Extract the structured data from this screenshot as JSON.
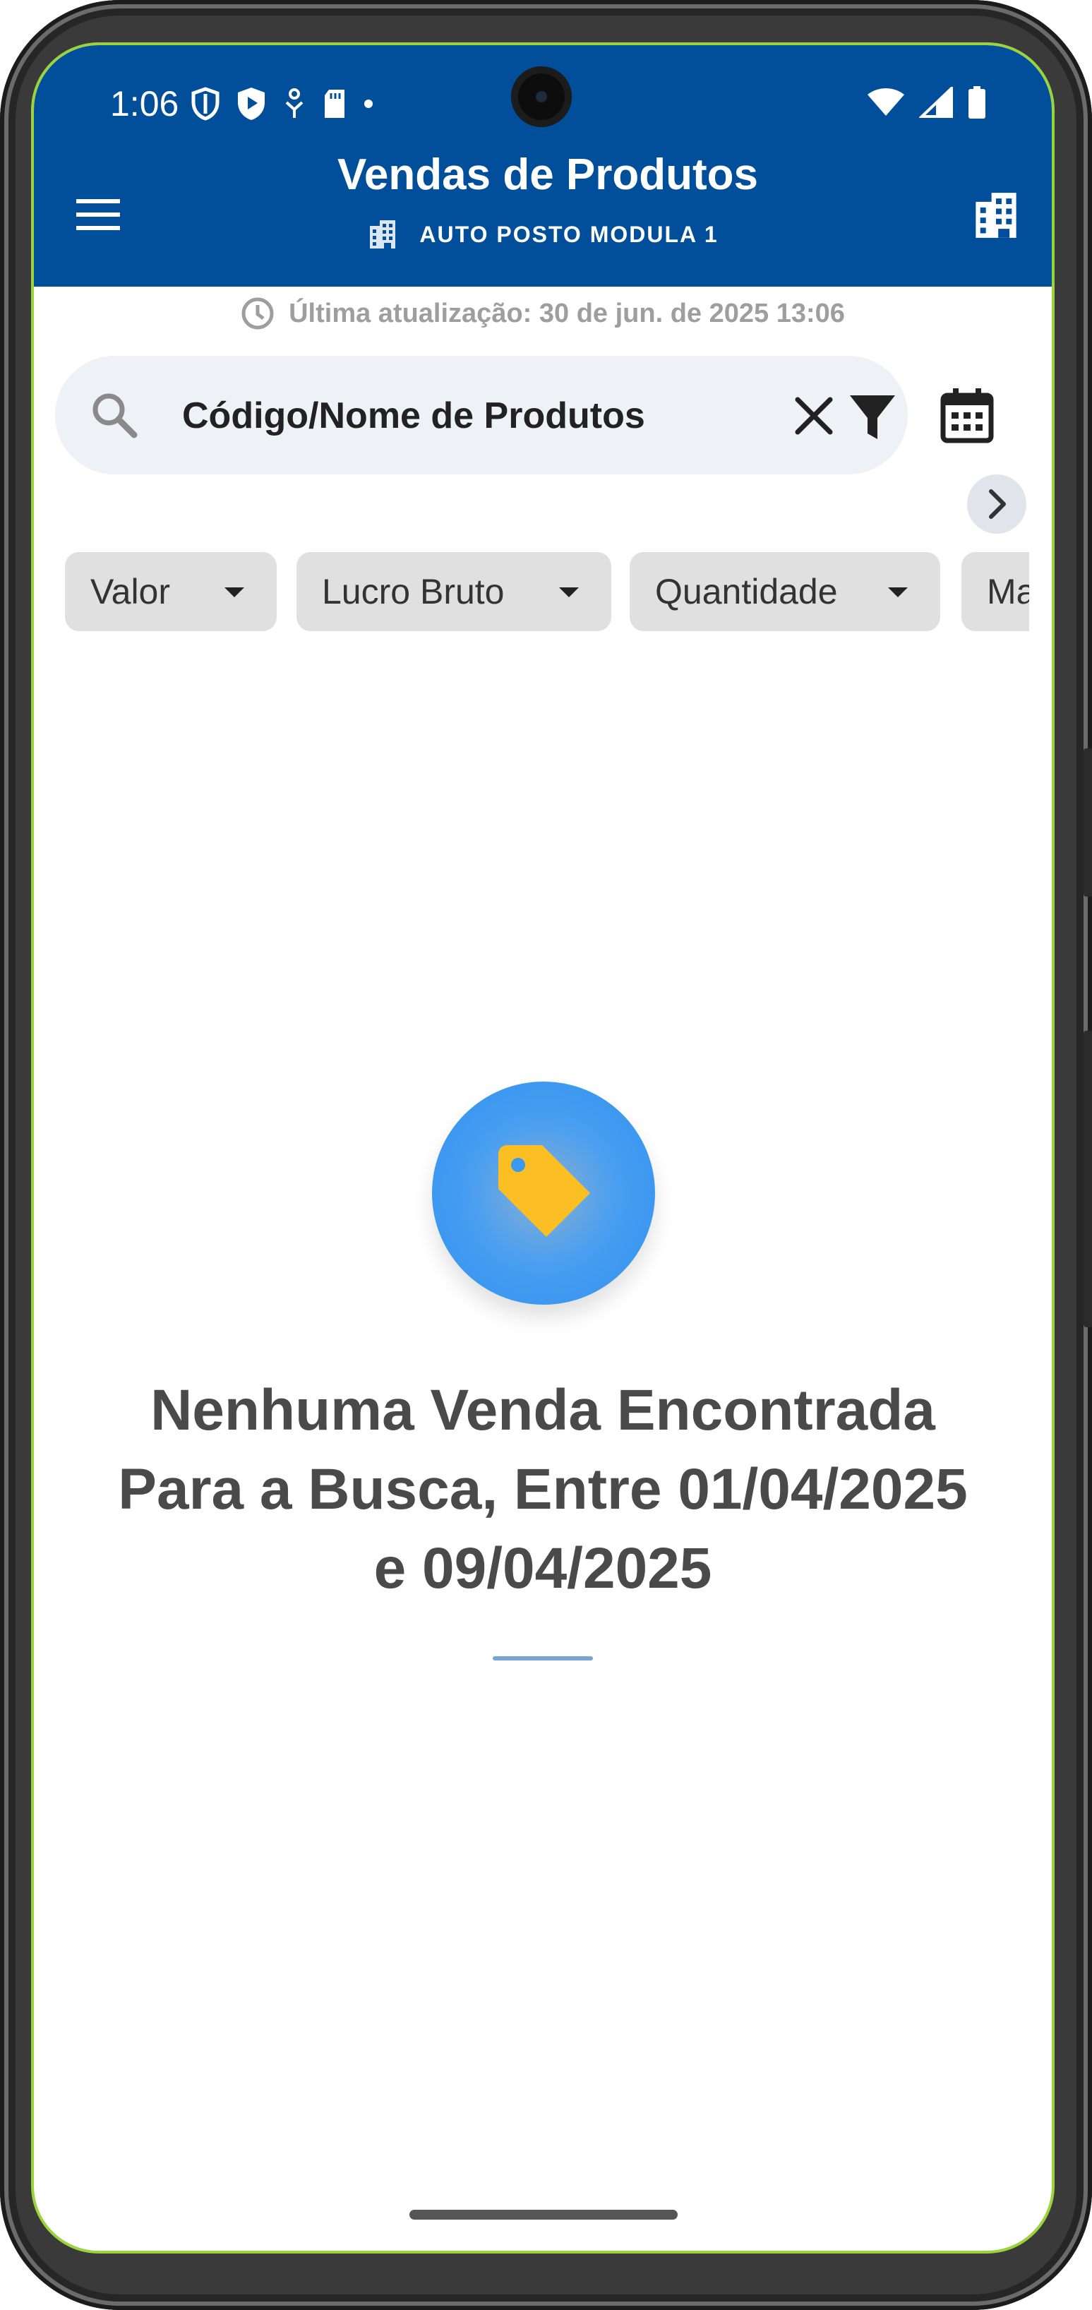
{
  "status_bar": {
    "time": "1:06"
  },
  "header": {
    "title": "Vendas de Produtos",
    "company": "AUTO POSTO MODULA 1"
  },
  "last_update": "Última atualização: 30 de jun. de 2025 13:06",
  "search": {
    "placeholder": "Código/Nome de Produtos",
    "value": ""
  },
  "chips": [
    {
      "label": "Valor"
    },
    {
      "label": "Lucro Bruto"
    },
    {
      "label": "Quantidade"
    },
    {
      "label": "Ma"
    }
  ],
  "empty_state": {
    "message": "Nenhuma Venda Encontrada Para a Busca, Entre 01/04/2025 e 09/04/2025"
  },
  "colors": {
    "app_bar": "#014f9a",
    "accent_circle": "#3d98f0",
    "tag_icon": "#fbbf24"
  },
  "icons": [
    "menu-icon",
    "building-icon",
    "clock-icon",
    "search-icon",
    "close-icon",
    "filter-icon",
    "calendar-icon",
    "chevron-right-icon",
    "tag-icon"
  ]
}
